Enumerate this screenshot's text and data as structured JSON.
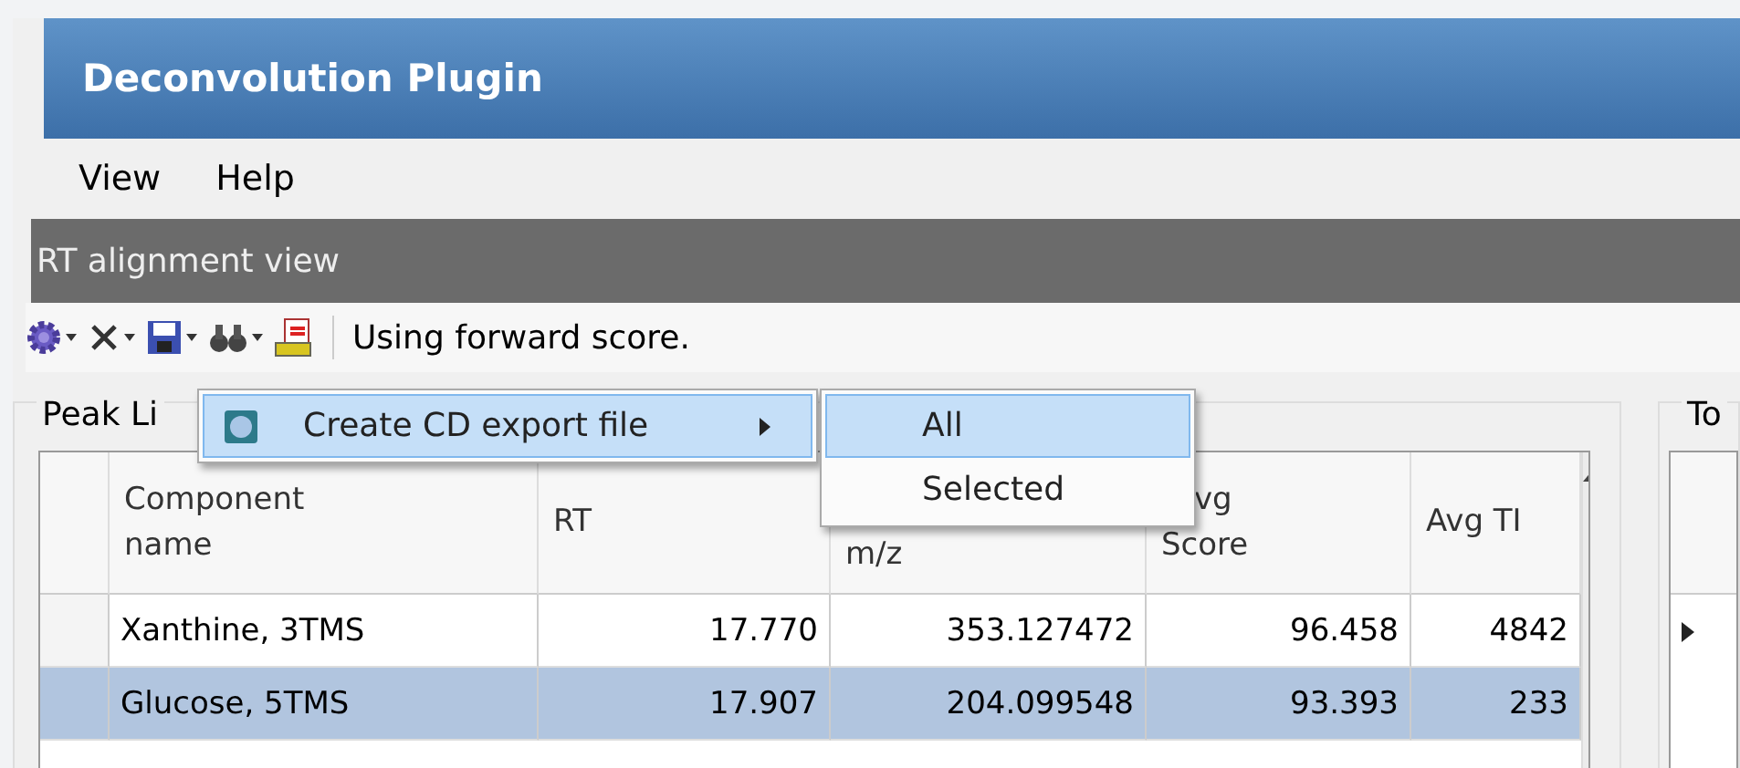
{
  "window": {
    "title": "Deconvolution Plugin"
  },
  "menu": [
    "View",
    "Help"
  ],
  "view_title": "RT alignment view",
  "toolbar": {
    "status": "Using forward score."
  },
  "peak_list": {
    "title": "Peak Li",
    "columns": [
      {
        "kind": "two_line",
        "lines": [
          "Component",
          "name"
        ]
      },
      {
        "kind": "single",
        "lines": [
          "RT"
        ]
      },
      {
        "kind": "lower",
        "lines": [
          "m/z"
        ]
      },
      {
        "kind": "tail",
        "lines": [
          "vg",
          "Score"
        ]
      },
      {
        "kind": "single",
        "lines": [
          "Avg TI"
        ]
      }
    ],
    "rows": [
      {
        "cells": [
          "Xanthine, 3TMS",
          "17.770",
          "353.127472",
          "96.458",
          "4842"
        ],
        "selected": false
      },
      {
        "cells": [
          "Glucose, 5TMS",
          "17.907",
          "204.099548",
          "93.393",
          "233"
        ],
        "selected": true
      }
    ]
  },
  "right_panel": {
    "title": "To"
  },
  "export_menu": {
    "items": [
      {
        "label": "Create CD export file",
        "selected": true
      }
    ],
    "submenu": [
      {
        "label": "All",
        "selected": true
      },
      {
        "label": "Selected",
        "selected": false
      }
    ]
  }
}
